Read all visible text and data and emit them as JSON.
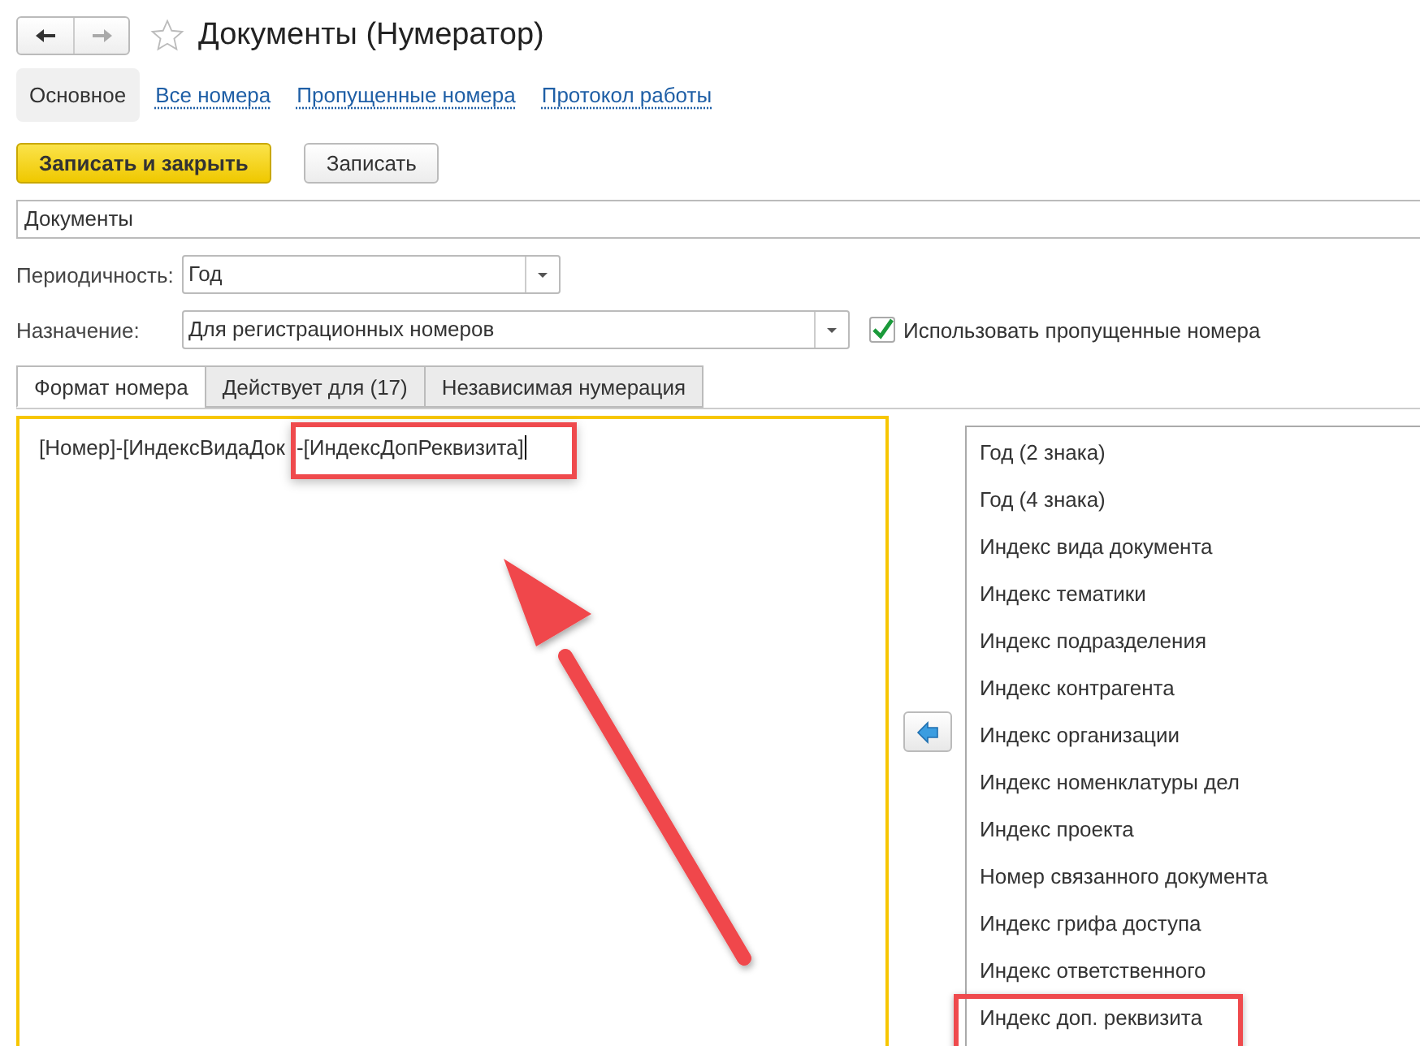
{
  "window": {
    "title": "Документы (Нумератор)",
    "favorite": false
  },
  "nav_links": [
    {
      "label": "Основное",
      "selected": true
    },
    {
      "label": "Все номера",
      "selected": false
    },
    {
      "label": "Пропущенные номера",
      "selected": false
    },
    {
      "label": "Протокол работы",
      "selected": false
    }
  ],
  "buttons": [
    {
      "label": "Записать и закрыть",
      "kind": "primary"
    },
    {
      "label": "Записать",
      "kind": "default"
    }
  ],
  "name_field": {
    "value": "Документы"
  },
  "fields": [
    {
      "label": "Периодичность:",
      "value": "Год",
      "wide": false
    },
    {
      "label": "Назначение:",
      "value": "Для регистрационных номеров",
      "wide": true
    }
  ],
  "use_skipped": {
    "label": "Использовать пропущенные номера",
    "checked": true
  },
  "tabs": [
    {
      "label": "Формат номера",
      "selected": true
    },
    {
      "label": "Действует для (17)",
      "selected": false
    },
    {
      "label": "Независимая нумерация",
      "selected": false
    }
  ],
  "format_segments": [
    {
      "text": "[Номер]-[ИндексВидаДок",
      "highlighted": false
    },
    {
      "text": "-[ИндексДопРеквизита]",
      "highlighted": true
    }
  ],
  "parts": [
    {
      "label": "Год (2 знака)",
      "highlighted": false
    },
    {
      "label": "Год (4 знака)",
      "highlighted": false
    },
    {
      "label": "Индекс вида документа",
      "highlighted": false
    },
    {
      "label": "Индекс тематики",
      "highlighted": false
    },
    {
      "label": "Индекс подразделения",
      "highlighted": false
    },
    {
      "label": "Индекс контрагента",
      "highlighted": false
    },
    {
      "label": "Индекс организации",
      "highlighted": false
    },
    {
      "label": "Индекс номенклатуры дел",
      "highlighted": false
    },
    {
      "label": "Индекс проекта",
      "highlighted": false
    },
    {
      "label": "Номер связанного документа",
      "highlighted": false
    },
    {
      "label": "Индекс грифа доступа",
      "highlighted": false
    },
    {
      "label": "Индекс ответственного",
      "highlighted": false
    },
    {
      "label": "Индекс доп. реквизита",
      "highlighted": true
    }
  ]
}
